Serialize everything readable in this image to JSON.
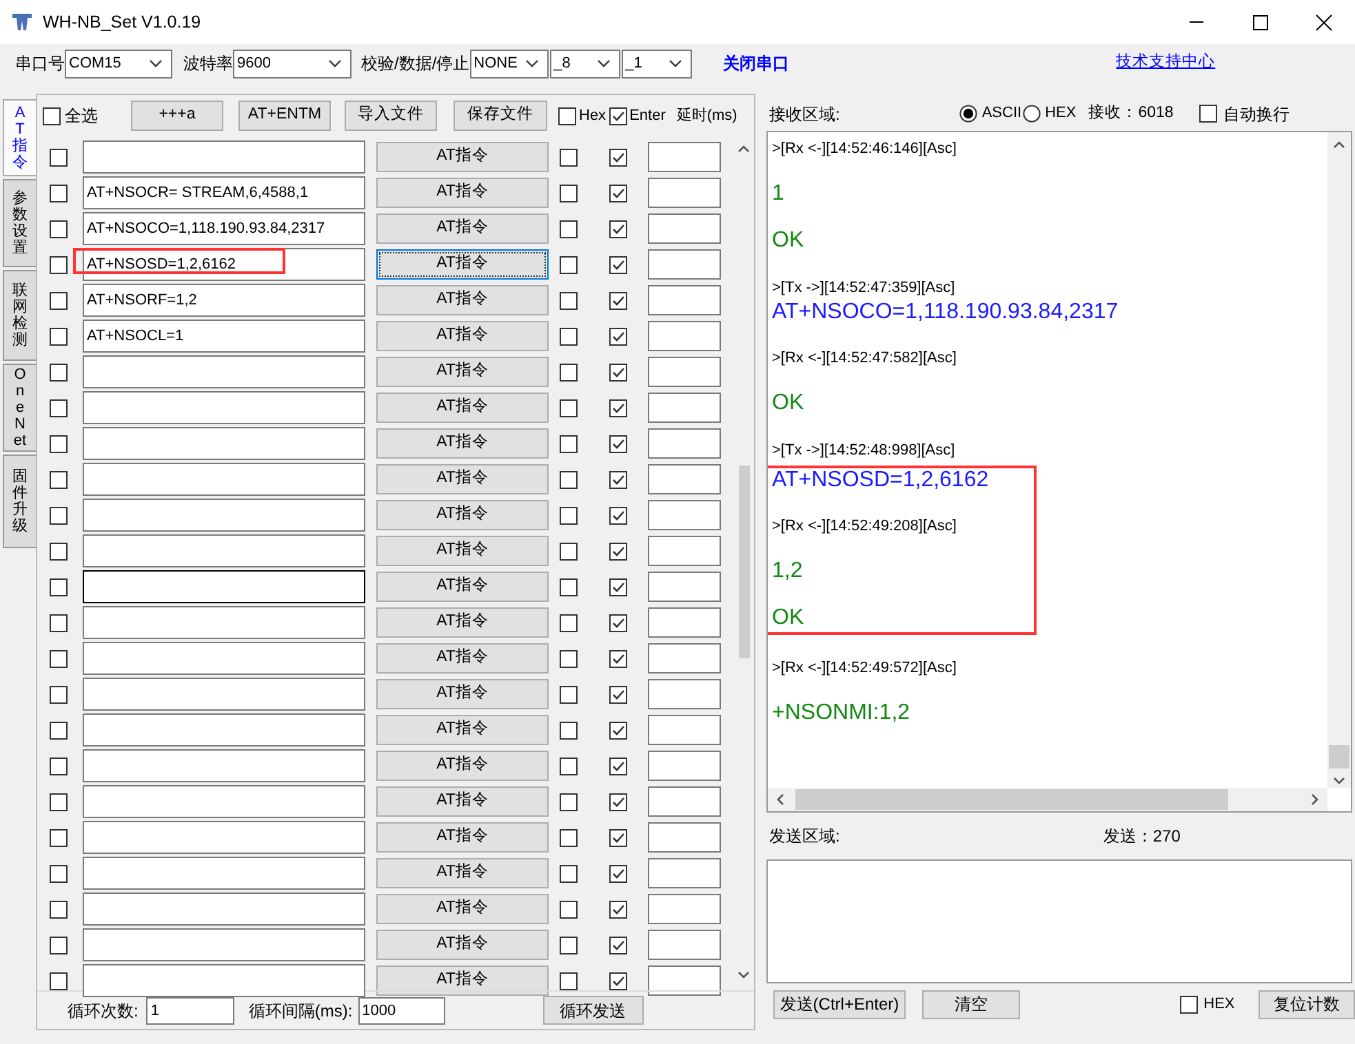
{
  "window": {
    "title": "WH-NB_Set V1.0.19"
  },
  "toolbar": {
    "port_label": "串口号",
    "port": "COM15",
    "baud_label": "波特率",
    "baud": "9600",
    "format_label": "校验/数据/停止",
    "parity": "NONE",
    "data_bits": "_8",
    "stop_bits": "_1",
    "close_port": "关闭串口",
    "support_link": "技术支持中心"
  },
  "side_tabs": [
    {
      "label": "AT指令",
      "selected": true
    },
    {
      "label": "参数设置",
      "selected": false
    },
    {
      "label": "联网检测",
      "selected": false
    },
    {
      "label": "OneNet",
      "selected": false
    },
    {
      "label": "固件升级",
      "selected": false
    }
  ],
  "command_bar": {
    "select_all": {
      "label": "全选",
      "checked": false
    },
    "buttons": [
      "+++a",
      "AT+ENTM",
      "导入文件",
      "保存文件"
    ],
    "hex": {
      "label": "Hex",
      "checked": false
    },
    "enter": {
      "label": "Enter",
      "checked": true
    },
    "delay_label": "延时(ms)"
  },
  "rows": [
    {
      "checked": false,
      "button": "AT指令",
      "hex": false,
      "enter": true,
      "highlighted": false,
      "button_focused": false,
      "input_focused": false
    },
    {
      "checked": false,
      "command": "AT+NSOCR= STREAM,6,4588,1",
      "button": "AT指令",
      "hex": false,
      "enter": true,
      "highlighted": false,
      "button_focused": false,
      "input_focused": false
    },
    {
      "checked": false,
      "command": "AT+NSOCO=1,118.190.93.84,2317",
      "button": "AT指令",
      "hex": false,
      "enter": true,
      "highlighted": false,
      "button_focused": false,
      "input_focused": false
    },
    {
      "checked": false,
      "command": "AT+NSOSD=1,2,6162",
      "button": "AT指令",
      "hex": false,
      "enter": true,
      "highlighted": true,
      "button_focused": true,
      "input_focused": false
    },
    {
      "checked": false,
      "command": "AT+NSORF=1,2",
      "button": "AT指令",
      "hex": false,
      "enter": true,
      "highlighted": false,
      "button_focused": false,
      "input_focused": false
    },
    {
      "checked": false,
      "command": "AT+NSOCL=1",
      "button": "AT指令",
      "hex": false,
      "enter": true,
      "highlighted": false,
      "button_focused": false,
      "input_focused": false
    },
    {
      "checked": false,
      "button": "AT指令",
      "hex": false,
      "enter": true,
      "highlighted": false,
      "button_focused": false,
      "input_focused": false
    },
    {
      "checked": false,
      "button": "AT指令",
      "hex": false,
      "enter": true,
      "highlighted": false,
      "button_focused": false,
      "input_focused": false
    },
    {
      "checked": false,
      "button": "AT指令",
      "hex": false,
      "enter": true,
      "highlighted": false,
      "button_focused": false,
      "input_focused": false
    },
    {
      "checked": false,
      "button": "AT指令",
      "hex": false,
      "enter": true,
      "highlighted": false,
      "button_focused": false,
      "input_focused": false
    },
    {
      "checked": false,
      "button": "AT指令",
      "hex": false,
      "enter": true,
      "highlighted": false,
      "button_focused": false,
      "input_focused": false
    },
    {
      "checked": false,
      "button": "AT指令",
      "hex": false,
      "enter": true,
      "highlighted": false,
      "button_focused": false,
      "input_focused": false
    },
    {
      "checked": false,
      "button": "AT指令",
      "hex": false,
      "enter": true,
      "highlighted": false,
      "button_focused": false,
      "input_focused": true
    },
    {
      "checked": false,
      "button": "AT指令",
      "hex": false,
      "enter": true,
      "highlighted": false,
      "button_focused": false,
      "input_focused": false
    },
    {
      "checked": false,
      "button": "AT指令",
      "hex": false,
      "enter": true,
      "highlighted": false,
      "button_focused": false,
      "input_focused": false
    },
    {
      "checked": false,
      "button": "AT指令",
      "hex": false,
      "enter": true,
      "highlighted": false,
      "button_focused": false,
      "input_focused": false
    },
    {
      "checked": false,
      "button": "AT指令",
      "hex": false,
      "enter": true,
      "highlighted": false,
      "button_focused": false,
      "input_focused": false
    },
    {
      "checked": false,
      "button": "AT指令",
      "hex": false,
      "enter": true,
      "highlighted": false,
      "button_focused": false,
      "input_focused": false
    },
    {
      "checked": false,
      "button": "AT指令",
      "hex": false,
      "enter": true,
      "highlighted": false,
      "button_focused": false,
      "input_focused": false
    },
    {
      "checked": false,
      "button": "AT指令",
      "hex": false,
      "enter": true,
      "highlighted": false,
      "button_focused": false,
      "input_focused": false
    },
    {
      "checked": false,
      "button": "AT指令",
      "hex": false,
      "enter": true,
      "highlighted": false,
      "button_focused": false,
      "input_focused": false
    },
    {
      "checked": false,
      "button": "AT指令",
      "hex": false,
      "enter": true,
      "highlighted": false,
      "button_focused": false,
      "input_focused": false
    },
    {
      "checked": false,
      "button": "AT指令",
      "hex": false,
      "enter": true,
      "highlighted": false,
      "button_focused": false,
      "input_focused": false
    },
    {
      "checked": false,
      "button": "AT指令",
      "hex": false,
      "enter": true,
      "highlighted": false,
      "button_focused": false,
      "input_focused": false
    }
  ],
  "loop": {
    "count_label": "循环次数:",
    "count": "1",
    "interval_label": "循环间隔(ms):",
    "interval": "1000",
    "send_button": "循环发送"
  },
  "receive": {
    "label": "接收区域:",
    "modes": [
      {
        "label": "ASCII",
        "selected": true
      },
      {
        "label": "HEX",
        "selected": false
      }
    ],
    "count": "接收：6018",
    "wrap": {
      "label": "自动换行",
      "checked": false
    },
    "log": [
      {
        "kind": "header",
        "text": ">[Rx <-][14:52:46:146][Asc]",
        "highlighted": false
      },
      {
        "kind": "rx",
        "text": "1",
        "highlighted": false
      },
      {
        "kind": "rx",
        "text": "OK",
        "highlighted": false
      },
      {
        "kind": "header",
        "text": ">[Tx ->][14:52:47:359][Asc]",
        "highlighted": false
      },
      {
        "kind": "tx",
        "text": "AT+NSOCO=1,118.190.93.84,2317",
        "highlighted": false
      },
      {
        "kind": "header",
        "text": ">[Rx <-][14:52:47:582][Asc]",
        "highlighted": false
      },
      {
        "kind": "rx",
        "text": "OK",
        "highlighted": false
      },
      {
        "kind": "header",
        "text": ">[Tx ->][14:52:48:998][Asc]",
        "highlighted": false
      },
      {
        "kind": "tx",
        "text": "AT+NSOSD=1,2,6162",
        "highlighted": true
      },
      {
        "kind": "header",
        "text": ">[Rx <-][14:52:49:208][Asc]",
        "highlighted": true
      },
      {
        "kind": "rx",
        "text": "1,2",
        "highlighted": true
      },
      {
        "kind": "rx",
        "text": "OK",
        "highlighted": true
      },
      {
        "kind": "header",
        "text": ">[Rx <-][14:52:49:572][Asc]",
        "highlighted": false
      },
      {
        "kind": "rx",
        "text": "+NSONMI:1,2",
        "highlighted": false
      }
    ]
  },
  "send": {
    "label": "发送区域:",
    "count": "发送：270",
    "send_button": "发送(Ctrl+Enter)",
    "clear_button": "清空",
    "hex": {
      "label": "HEX",
      "checked": false
    },
    "reset_button": "复位计数"
  }
}
